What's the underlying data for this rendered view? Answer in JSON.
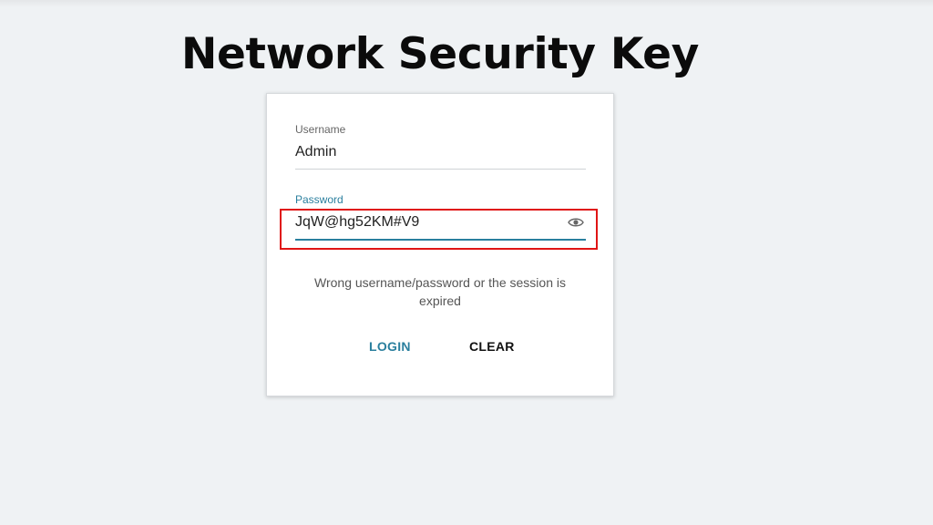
{
  "page": {
    "title": "Network Security Key"
  },
  "login_form": {
    "username": {
      "label": "Username",
      "value": "Admin"
    },
    "password": {
      "label": "Password",
      "value": "JqW@hg52KM#V9",
      "toggle_icon": "eye-icon"
    },
    "error_message": "Wrong username/password or the session is expired",
    "login_label": "LOGIN",
    "clear_label": "CLEAR"
  },
  "colors": {
    "accent": "#2a7f9e",
    "highlight": "#e01515",
    "background": "#eff2f4"
  }
}
